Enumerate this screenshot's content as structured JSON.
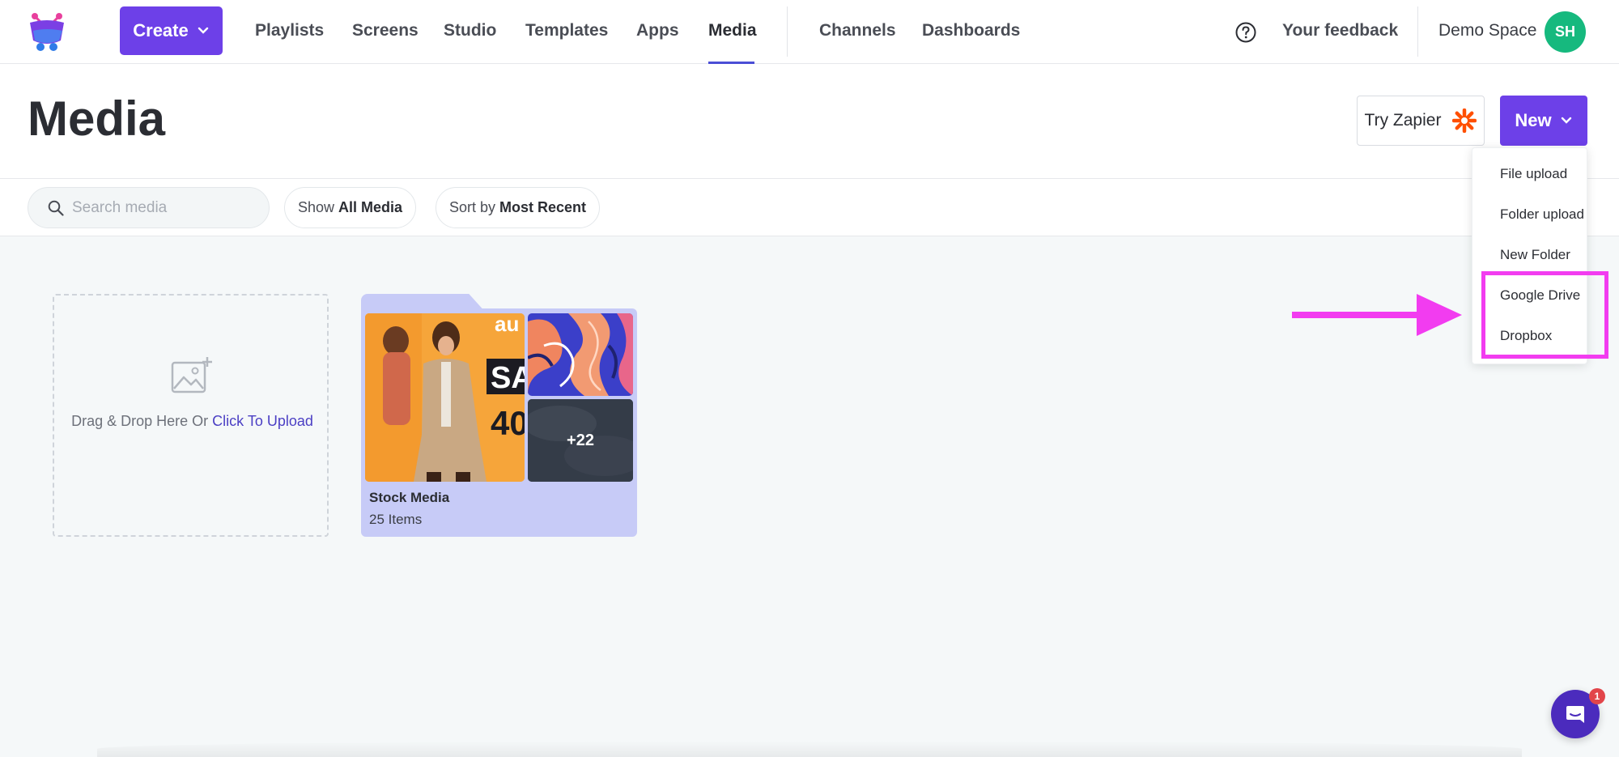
{
  "nav": {
    "create_label": "Create",
    "links": [
      "Playlists",
      "Screens",
      "Studio",
      "Templates",
      "Apps",
      "Media",
      "Channels",
      "Dashboards"
    ],
    "active": "Media",
    "feedback": "Your feedback",
    "space_name": "Demo Space",
    "avatar_initials": "SH"
  },
  "header": {
    "title": "Media",
    "zapier_label": "Try Zapier",
    "new_label": "New"
  },
  "toolbar": {
    "search_placeholder": "Search media",
    "show_prefix": "Show",
    "show_value": "All Media",
    "sort_prefix": "Sort by",
    "sort_value": "Most Recent"
  },
  "dropzone": {
    "text": "Drag & Drop Here Or",
    "link": "Click To Upload"
  },
  "folder": {
    "name": "Stock Media",
    "count": "25 Items",
    "more": "+22"
  },
  "new_menu": {
    "items": [
      "File upload",
      "Folder upload",
      "New Folder",
      "Google Drive",
      "Dropbox"
    ],
    "highlighted": [
      "Google Drive",
      "Dropbox"
    ]
  },
  "chat": {
    "badge": "1"
  },
  "colors": {
    "primary": "#6d40e8",
    "avatar": "#16b97e",
    "highlight": "#f23cf0",
    "folder": "#c7cbf7",
    "zapier": "#ff4f00"
  }
}
